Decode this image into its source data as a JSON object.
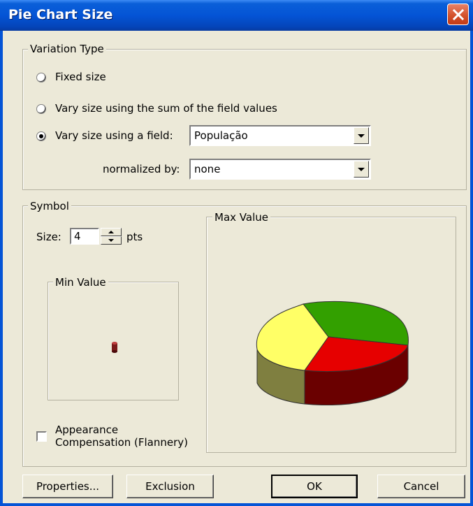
{
  "window": {
    "title": "Pie Chart Size",
    "close_icon": "close-icon"
  },
  "variation_group": {
    "legend": "Variation Type",
    "options": [
      {
        "label": "Fixed size",
        "selected": false
      },
      {
        "label": "Vary size using the sum of the field values",
        "selected": false
      },
      {
        "label": "Vary size using a field:",
        "selected": true
      }
    ],
    "field_combo": {
      "value": "População"
    },
    "normalized_label": "normalized by:",
    "normalized_combo": {
      "value": "none"
    }
  },
  "symbol_group": {
    "legend": "Symbol",
    "size_label": "Size:",
    "size_value": "4",
    "size_unit": "pts",
    "min_value_legend": "Min Value",
    "max_value_legend": "Max Value",
    "appearance_label_line1": "Appearance",
    "appearance_label_line2": "Compensation (Flannery)",
    "appearance_checked": false
  },
  "pie_colors": {
    "yellow": "#ffff66",
    "green": "#33a000",
    "red": "#e60000",
    "yellow_side": "#7f7f40",
    "red_side": "#6a0000",
    "min_symbol": "#7a1a1a"
  },
  "buttons": {
    "properties": "Properties...",
    "exclusion": "Exclusion",
    "ok": "OK",
    "cancel": "Cancel"
  }
}
